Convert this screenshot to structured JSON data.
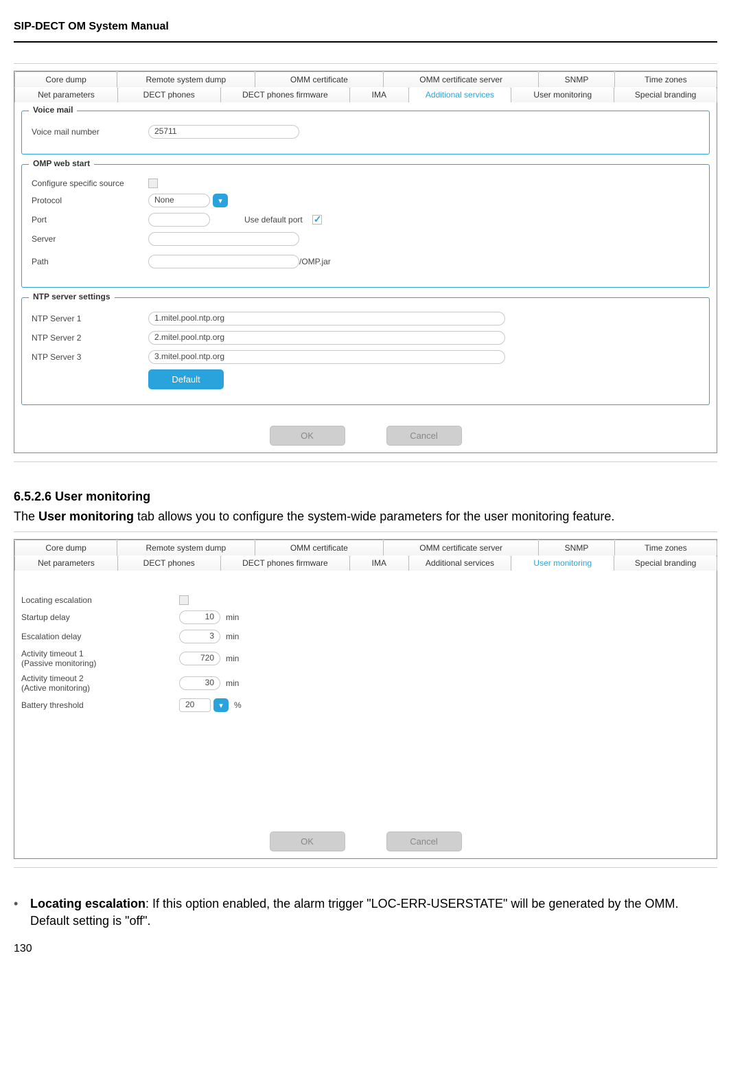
{
  "header": {
    "title": "SIP-DECT OM System Manual"
  },
  "fig1": {
    "tabs_top": [
      "Core dump",
      "Remote system dump",
      "OMM certificate",
      "OMM certificate server",
      "SNMP",
      "Time zones"
    ],
    "tabs_bottom": [
      "Net parameters",
      "DECT phones",
      "DECT phones firmware",
      "IMA",
      "Additional services",
      "User monitoring",
      "Special branding"
    ],
    "active_tab": "Additional services",
    "voice_mail": {
      "legend": "Voice mail",
      "number_label": "Voice mail number",
      "number_value": "25711"
    },
    "omp": {
      "legend": "OMP web start",
      "source_label": "Configure specific source",
      "protocol_label": "Protocol",
      "protocol_value": "None",
      "port_label": "Port",
      "default_port_label": "Use default port",
      "server_label": "Server",
      "path_label": "Path",
      "path_suffix": "/OMP.jar"
    },
    "ntp": {
      "legend": "NTP server settings",
      "s1_label": "NTP Server 1",
      "s1_value": "1.mitel.pool.ntp.org",
      "s2_label": "NTP Server 2",
      "s2_value": "2.mitel.pool.ntp.org",
      "s3_label": "NTP Server 3",
      "s3_value": "3.mitel.pool.ntp.org",
      "default_label": "Default"
    },
    "ok_label": "OK",
    "cancel_label": "Cancel"
  },
  "section": {
    "number": "6.5.2.6",
    "title": "User monitoring",
    "paragraph_pre": "The ",
    "paragraph_bold": "User monitoring",
    "paragraph_post": " tab allows you to configure the system-wide parameters for the user monitoring feature."
  },
  "fig2": {
    "tabs_top": [
      "Core dump",
      "Remote system dump",
      "OMM certificate",
      "OMM certificate server",
      "SNMP",
      "Time zones"
    ],
    "tabs_bottom": [
      "Net parameters",
      "DECT phones",
      "DECT phones firmware",
      "IMA",
      "Additional services",
      "User monitoring",
      "Special branding"
    ],
    "active_tab": "User monitoring",
    "rows": {
      "locating_label": "Locating escalation",
      "startup_label": "Startup delay",
      "startup_value": "10",
      "min": "min",
      "escal_label": "Escalation delay",
      "escal_value": "3",
      "act1_label_a": "Activity timeout 1",
      "act1_label_b": "(Passive monitoring)",
      "act1_value": "720",
      "act2_label_a": "Activity timeout 2",
      "act2_label_b": "(Active monitoring)",
      "act2_value": "30",
      "batt_label": "Battery threshold",
      "batt_value": "20",
      "pct": "%"
    },
    "ok_label": "OK",
    "cancel_label": "Cancel"
  },
  "bullet": {
    "bold": "Locating escalation",
    "text": ": If this option enabled, the alarm trigger \"LOC-ERR-USERSTATE\" will be generated by the OMM. Default setting is \"off\"."
  },
  "page_number": "130"
}
